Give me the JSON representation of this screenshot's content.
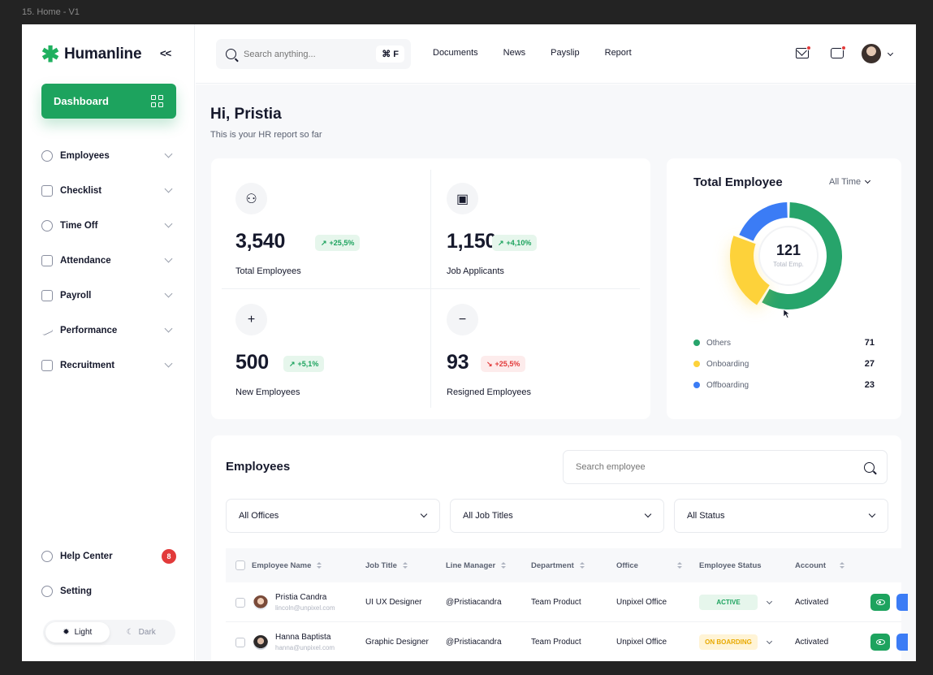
{
  "frame_label": "15. Home - V1",
  "brand": {
    "name": "Humanline",
    "collapse": "<<"
  },
  "sidebar": {
    "dashboard": "Dashboard",
    "items": [
      {
        "label": "Employees"
      },
      {
        "label": "Checklist"
      },
      {
        "label": "Time Off"
      },
      {
        "label": "Attendance"
      },
      {
        "label": "Payroll"
      },
      {
        "label": "Performance"
      },
      {
        "label": "Recruitment"
      }
    ],
    "help": "Help Center",
    "help_badge": "8",
    "setting": "Setting",
    "theme_light": "Light",
    "theme_dark": "Dark"
  },
  "header": {
    "search_placeholder": "Search anything...",
    "shortcut": "⌘ F",
    "nav": [
      "Documents",
      "News",
      "Payslip",
      "Report"
    ]
  },
  "greeting": {
    "title": "Hi, Pristia",
    "subtitle": "This is your HR report so far"
  },
  "stats": [
    {
      "value": "3,540",
      "change": "+25,5%",
      "trend": "up",
      "label": "Total  Employees"
    },
    {
      "value": "1,150",
      "change": "+4,10%",
      "trend": "up",
      "label": "Job Applicants"
    },
    {
      "value": "500",
      "change": "+5,1%",
      "trend": "up",
      "label": "New  Employees"
    },
    {
      "value": "93",
      "change": "+25,5%",
      "trend": "down",
      "label": "Resigned Employees"
    }
  ],
  "total_employee": {
    "title": "Total Employee",
    "filter": "All Time",
    "center_value": "121",
    "center_label": "Total Emp.",
    "segments": [
      {
        "label": "Others",
        "value": 71,
        "color": "#27a46b"
      },
      {
        "label": "Onboarding",
        "value": 27,
        "color": "#fdd23a"
      },
      {
        "label": "Offboarding",
        "value": 23,
        "color": "#3b7cf5"
      }
    ]
  },
  "employees": {
    "title": "Employees",
    "search_placeholder": "Search employee",
    "filters": [
      "All Offices",
      "All Job Titles",
      "All Status"
    ],
    "columns": [
      "Employee Name",
      "Job Title",
      "Line Manager",
      "Department",
      "Office",
      "Employee Status",
      "Account"
    ],
    "rows": [
      {
        "name": "Pristia Candra",
        "email": "lincoln@unpixel.com",
        "job": "UI UX Designer",
        "manager": "@Pristiacandra",
        "dept": "Team Product",
        "office": "Unpixel Office",
        "status": "ACTIVE",
        "account": "Activated"
      },
      {
        "name": "Hanna Baptista",
        "email": "hanna@unpixel.com",
        "job": "Graphic Designer",
        "manager": "@Pristiacandra",
        "dept": "Team Product",
        "office": "Unpixel Office",
        "status": "ON BOARDING",
        "account": "Activated"
      }
    ]
  }
}
